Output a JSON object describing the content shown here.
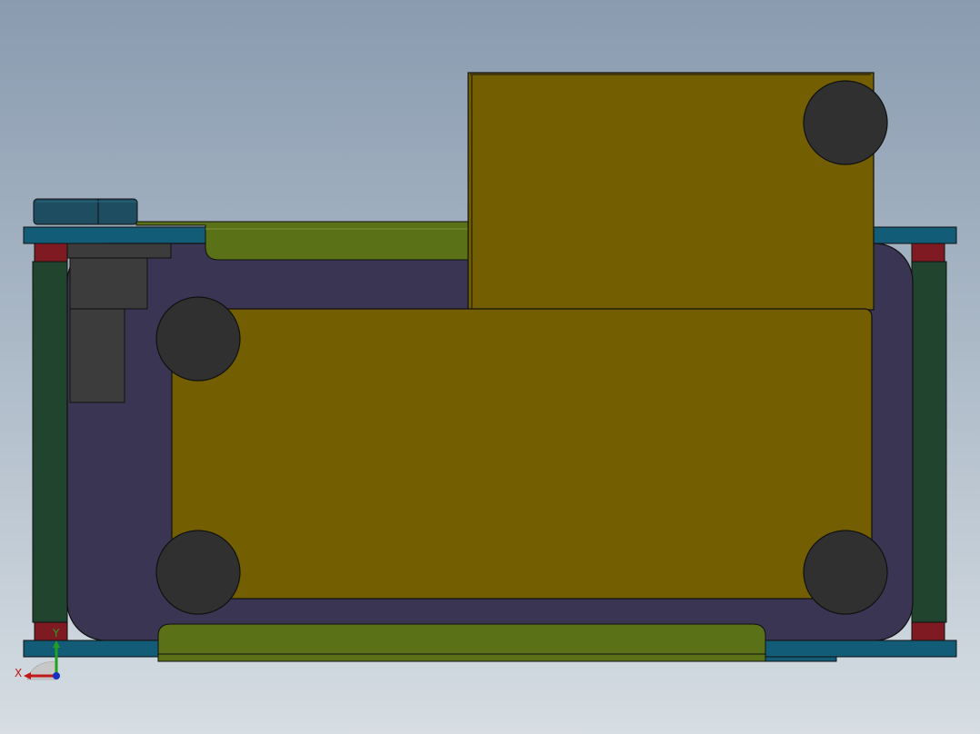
{
  "view": {
    "background_top": "#8a9bb0",
    "background_bottom": "#d6dde3"
  },
  "colors": {
    "mustard_plate": "#735f02",
    "purple_frame": "#3a3552",
    "olive_rail": "#5a7118",
    "teal_bar": "#135c78",
    "dark_green_roller": "#21442f",
    "red_spacer": "#7f1a22",
    "bolt_head": "#303030",
    "gray_block": "#3c3c3c",
    "hex_nut": "#1e4c60",
    "outline": "#101010"
  },
  "triad": {
    "x_label": "X",
    "y_label": "Y",
    "x_axis_color": "#c01818",
    "y_axis_color": "#22a022",
    "z_axis_color": "#1830c0"
  }
}
